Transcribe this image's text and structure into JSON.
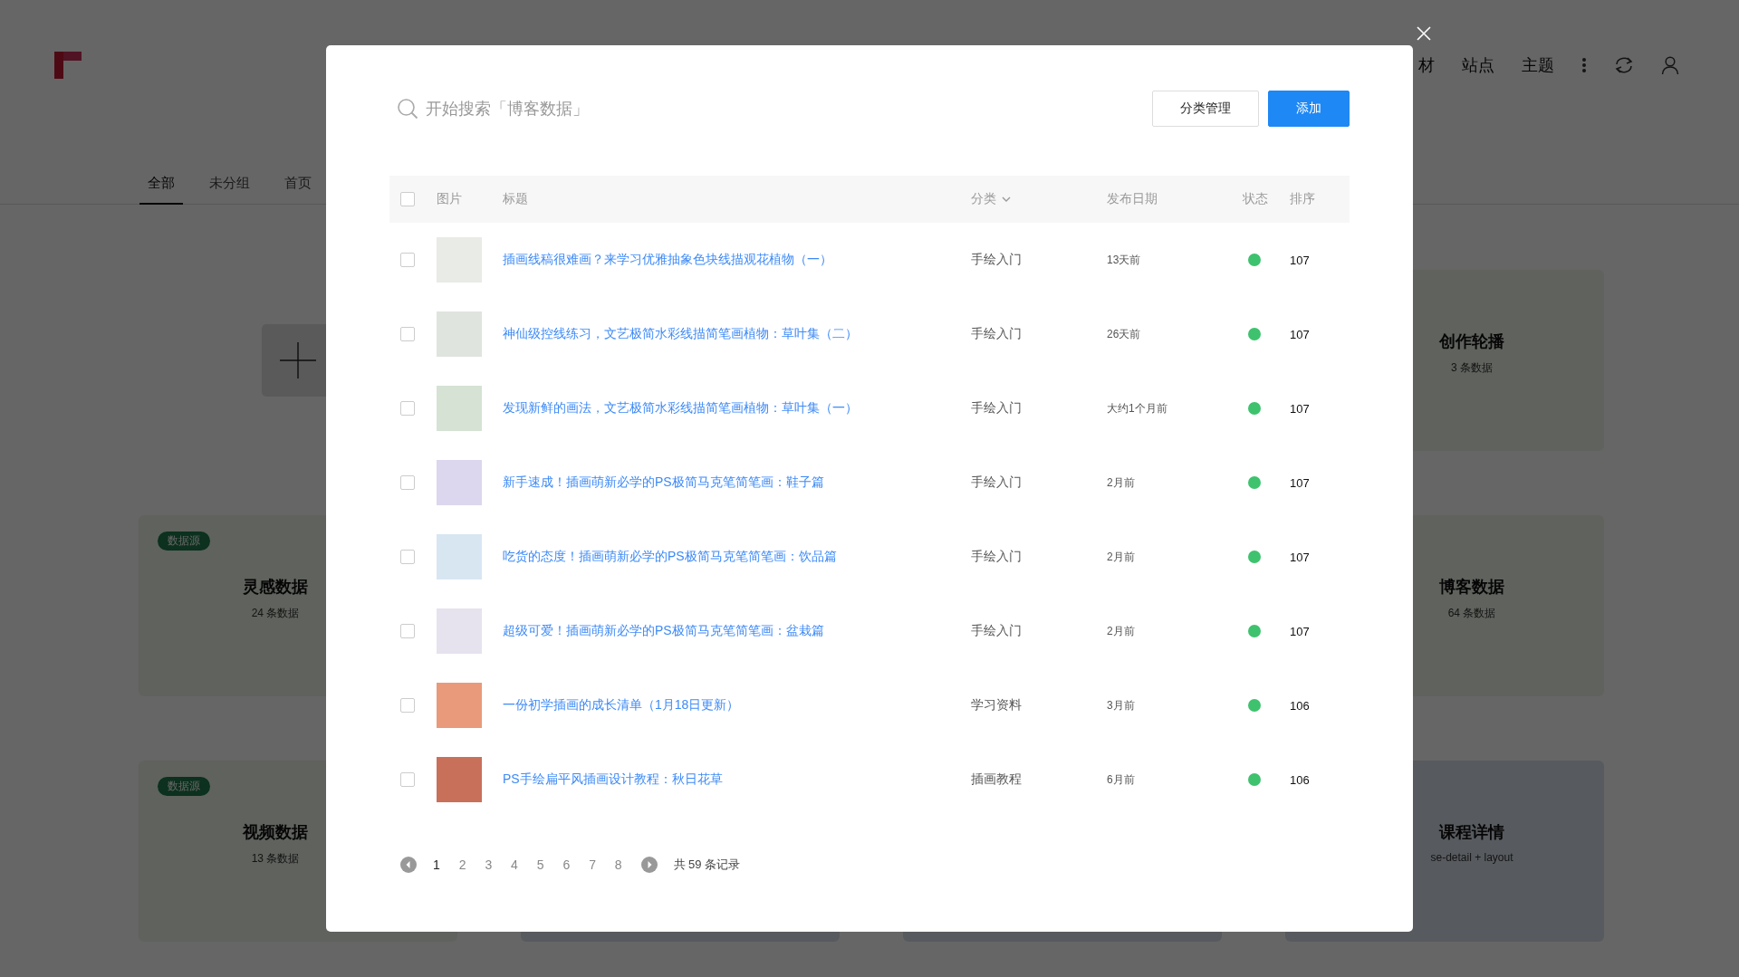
{
  "header": {
    "nav": [
      {
        "label": "材"
      },
      {
        "label": "站点"
      },
      {
        "label": "主题"
      }
    ]
  },
  "tabs": [
    {
      "label": "全部",
      "selected": true
    },
    {
      "label": "未分组",
      "selected": false
    },
    {
      "label": "首页",
      "selected": false
    }
  ],
  "left_column": [
    {
      "kind": "add"
    },
    {
      "kind": "source",
      "badge": "数据源",
      "title": "灵感数据",
      "count": "24 条数据"
    },
    {
      "kind": "source",
      "badge": "数据源",
      "title": "视频数据",
      "count": "13 条数据"
    }
  ],
  "right_column": [
    {
      "kind": "data",
      "title": "创作轮播",
      "count": "3 条数据"
    },
    {
      "kind": "data",
      "title": "博客数据",
      "count": "64 条数据"
    },
    {
      "kind": "page",
      "title": "课程详情",
      "count": "se-detail + layout"
    }
  ],
  "dialog": {
    "search": {
      "placeholder": "开始搜索「博客数据」"
    },
    "buttons": [
      {
        "label": "分类管理",
        "kind": "default"
      },
      {
        "label": "添加",
        "kind": "primary"
      }
    ],
    "table": {
      "header_checked": false,
      "columns": [
        {
          "label": "图片",
          "dropdown": false
        },
        {
          "label": "标题",
          "dropdown": false
        },
        {
          "label": "分类",
          "dropdown": true
        },
        {
          "label": "发布日期",
          "dropdown": false
        },
        {
          "label": "状态",
          "dropdown": false
        },
        {
          "label": "排序",
          "dropdown": false
        }
      ],
      "rows": [
        {
          "checked": false,
          "title": "插画线稿很难画？来学习优雅抽象色块线描观花植物（一）",
          "category": "手绘入门",
          "date": "13天前",
          "active": true,
          "order": "107"
        },
        {
          "checked": false,
          "title": "神仙级控线练习，文艺极简水彩线描简笔画植物：草叶集（二）",
          "category": "手绘入门",
          "date": "26天前",
          "active": true,
          "order": "107"
        },
        {
          "checked": false,
          "title": "发现新鲜的画法，文艺极简水彩线描简笔画植物：草叶集（一）",
          "category": "手绘入门",
          "date": "大约1个月前",
          "active": true,
          "order": "107"
        },
        {
          "checked": false,
          "title": "新手速成！插画萌新必学的PS极简马克笔简笔画：鞋子篇",
          "category": "手绘入门",
          "date": "2月前",
          "active": true,
          "order": "107"
        },
        {
          "checked": false,
          "title": "吃货的态度！插画萌新必学的PS极简马克笔简笔画：饮品篇",
          "category": "手绘入门",
          "date": "2月前",
          "active": true,
          "order": "107"
        },
        {
          "checked": false,
          "title": "超级可爱！插画萌新必学的PS极简马克笔简笔画：盆栽篇",
          "category": "手绘入门",
          "date": "2月前",
          "active": true,
          "order": "107"
        },
        {
          "checked": false,
          "title": "一份初学插画的成长清单（1月18日更新）",
          "category": "学习资料",
          "date": "3月前",
          "active": true,
          "order": "106"
        },
        {
          "checked": false,
          "title": "PS手绘扁平风插画设计教程：秋日花草",
          "category": "插画教程",
          "date": "6月前",
          "active": true,
          "order": "106"
        }
      ]
    },
    "pagination": {
      "pages": [
        {
          "label": "1",
          "selected": true
        },
        {
          "label": "2",
          "selected": false
        },
        {
          "label": "3",
          "selected": false
        },
        {
          "label": "4",
          "selected": false
        },
        {
          "label": "5",
          "selected": false
        },
        {
          "label": "6",
          "selected": false
        },
        {
          "label": "7",
          "selected": false
        },
        {
          "label": "8",
          "selected": false
        }
      ],
      "total": "共 59 条记录"
    }
  }
}
